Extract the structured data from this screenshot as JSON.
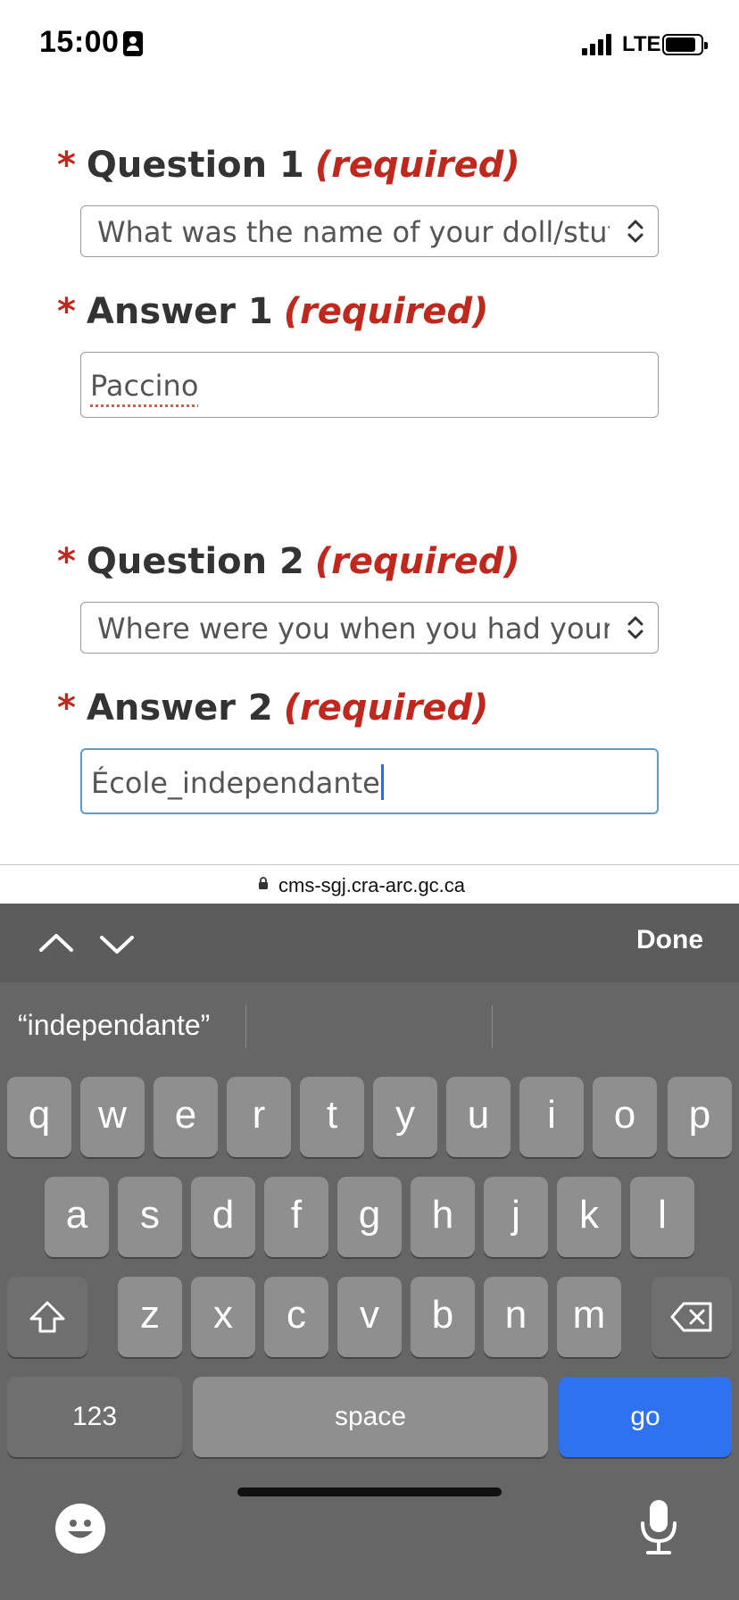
{
  "status_bar": {
    "time": "15:00",
    "network": "LTE",
    "icons": [
      "id-card-icon",
      "signal-icon",
      "battery-icon"
    ]
  },
  "form": {
    "question1": {
      "asterisk": "*",
      "label": "Question 1",
      "required": "(required)",
      "selected": "What was the name of your doll/stuffe"
    },
    "answer1": {
      "asterisk": "*",
      "label": "Answer 1",
      "required": "(required)",
      "value": "Paccino"
    },
    "question2": {
      "asterisk": "*",
      "label": "Question 2",
      "required": "(required)",
      "selected": "Where were you when you had your fir"
    },
    "answer2": {
      "asterisk": "*",
      "label": "Answer 2",
      "required": "(required)",
      "value": "École_independante"
    }
  },
  "browser": {
    "url": "cms-sgj.cra-arc.gc.ca"
  },
  "accessory": {
    "done_label": "Done"
  },
  "keyboard": {
    "suggestion": "“independante”",
    "row1": [
      "q",
      "w",
      "e",
      "r",
      "t",
      "y",
      "u",
      "i",
      "o",
      "p"
    ],
    "row2": [
      "a",
      "s",
      "d",
      "f",
      "g",
      "h",
      "j",
      "k",
      "l"
    ],
    "row3": [
      "z",
      "x",
      "c",
      "v",
      "b",
      "n",
      "m"
    ],
    "numbers_label": "123",
    "space_label": "space",
    "go_label": "go"
  },
  "colors": {
    "required_red": "#c0281e",
    "focus_blue": "#5b9bd5",
    "go_blue": "#2e72f0",
    "keyboard_bg": "#666666"
  }
}
